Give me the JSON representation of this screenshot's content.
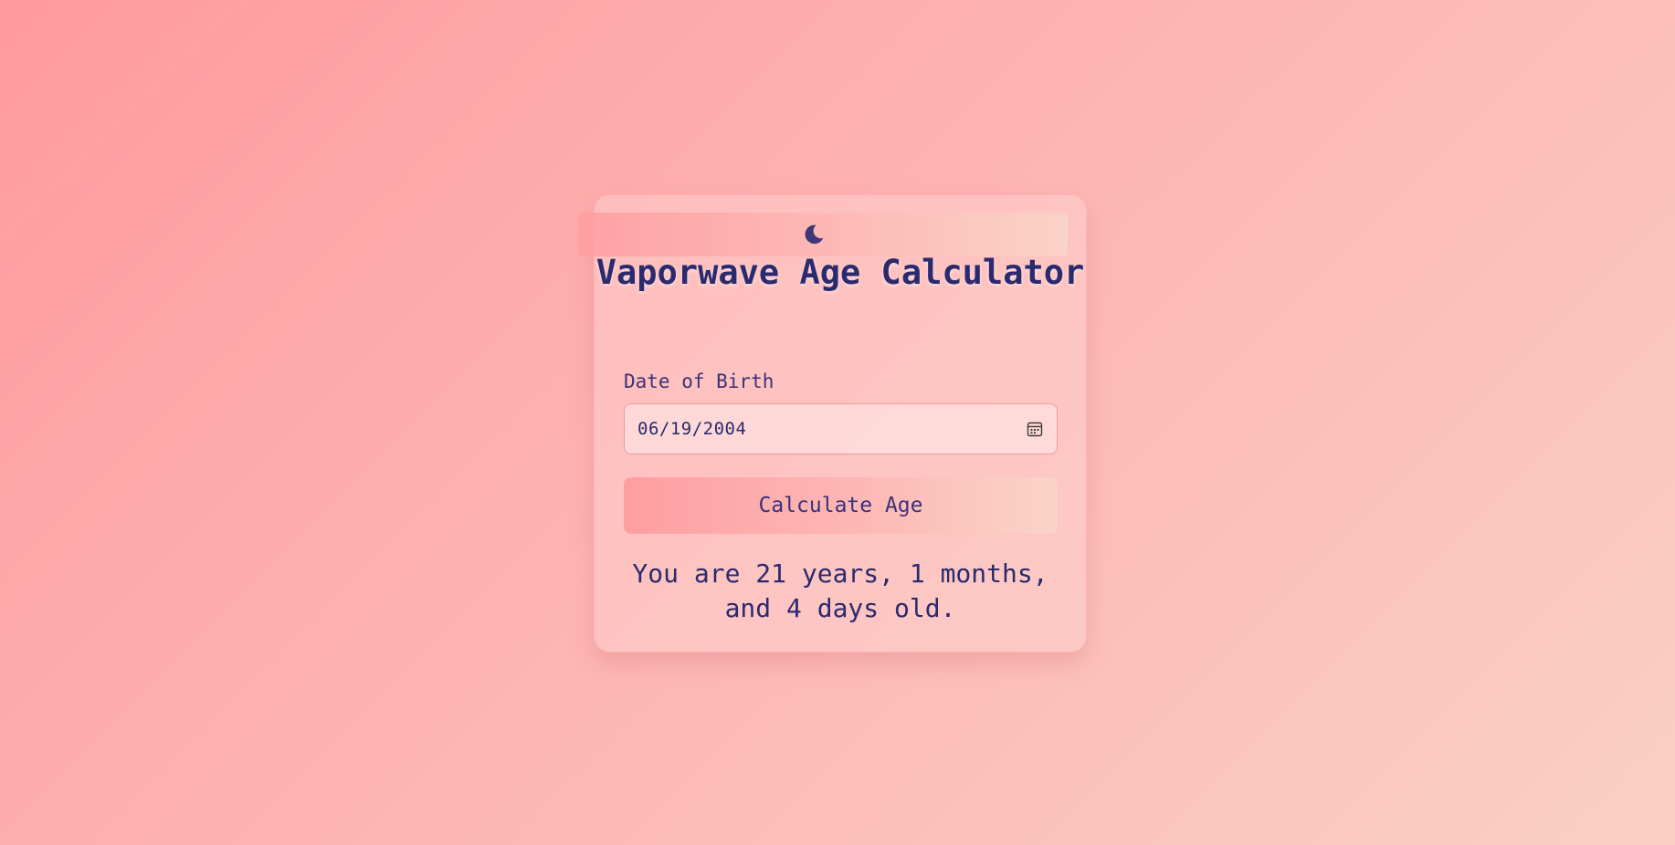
{
  "app": {
    "title": "Vaporwave Age Calculator"
  },
  "theme_toggle": {
    "icon": "moon-icon"
  },
  "form": {
    "dob_label": "Date of Birth",
    "dob_value": "06/19/2004",
    "calendar_icon": "calendar-icon",
    "calculate_label": "Calculate Age"
  },
  "result": {
    "text": "You are 21 years, 1 months, and 4 days old."
  },
  "colors": {
    "background_start": "#ff9a9e",
    "background_end": "#fad0c4",
    "text": "#2a2a6e",
    "input_border": "#ee9aa4"
  }
}
